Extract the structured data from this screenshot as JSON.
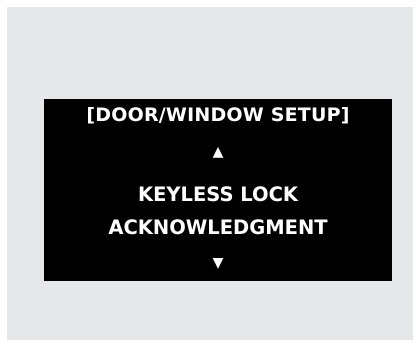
{
  "screen": {
    "title": "[DOOR/WINDOW SETUP]",
    "up_icon": "up-triangle-icon",
    "up_glyph": "▲",
    "menu_item": {
      "line1": "KEYLESS LOCK",
      "line2": "ACKNOWLEDGMENT"
    },
    "down_icon": "down-triangle-icon",
    "down_glyph": "▼"
  },
  "colors": {
    "screen_background": "#000000",
    "text": "#ffffff",
    "frame": "#e6e7e8"
  }
}
